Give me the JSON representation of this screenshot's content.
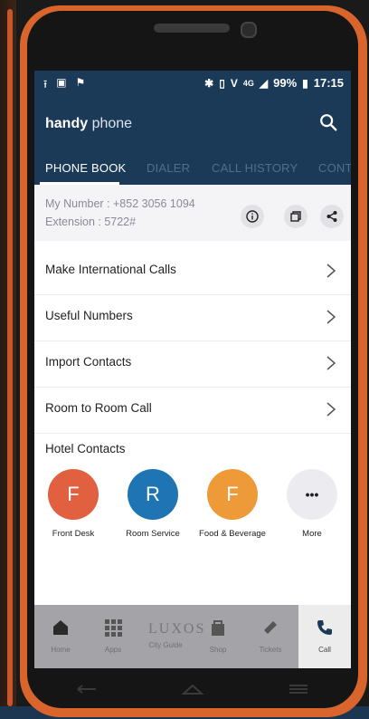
{
  "status_bar": {
    "battery": "99%",
    "time": "17:15",
    "network_4g": "4G",
    "icons_left": [
      "upload-icon",
      "image-icon",
      "flag-icon"
    ],
    "icons_right": [
      "bluetooth-icon",
      "vibrate-icon",
      "volte-icon",
      "signal-icon",
      "battery-icon"
    ]
  },
  "app_bar": {
    "brand_bold": "handy",
    "brand_light": "phone",
    "action_icon": "search-icon"
  },
  "tabs": [
    {
      "label": "PHONE BOOK",
      "active": true
    },
    {
      "label": "DIALER",
      "active": false
    },
    {
      "label": "CALL HISTORY",
      "active": false
    },
    {
      "label": "CONTA",
      "active": false
    }
  ],
  "my_number": {
    "number_line": "My Number : +852 3056 1094",
    "extension_line": "Extension :   5722#",
    "actions": [
      "info-icon",
      "copy-icon",
      "share-icon"
    ]
  },
  "menu": [
    {
      "label": "Make  International Calls"
    },
    {
      "label": "Useful Numbers"
    },
    {
      "label": "Import Contacts"
    },
    {
      "label": "Room to Room Call"
    }
  ],
  "hotel_contacts": {
    "title": "Hotel Contacts",
    "items": [
      {
        "initial": "F",
        "name": "Front Desk",
        "color": "#e0603f"
      },
      {
        "initial": "R",
        "name": "Room Service",
        "color": "#1f74b4"
      },
      {
        "initial": "F",
        "name": "Food & Beverage",
        "color": "#ef9a38"
      },
      {
        "initial": "•••",
        "name": "More",
        "color": "#ecebf0"
      }
    ]
  },
  "bottom_nav": {
    "logo_text": "LUXOS",
    "items": [
      {
        "label": "Home",
        "icon": "home-icon"
      },
      {
        "label": "Apps",
        "icon": "apps-grid-icon"
      },
      {
        "label": "City Guide",
        "icon": "city-guide-icon"
      },
      {
        "label": "Shop",
        "icon": "shopping-bag-icon"
      },
      {
        "label": "Tickets",
        "icon": "ticket-icon"
      },
      {
        "label": "Call",
        "icon": "phone-icon"
      }
    ]
  }
}
